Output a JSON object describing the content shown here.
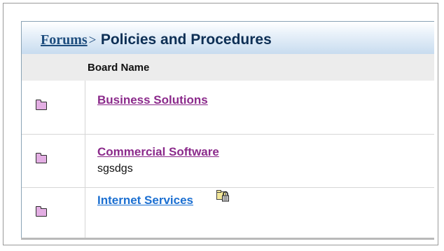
{
  "breadcrumb": {
    "root_label": "Forums",
    "separator": ">",
    "current_label": "Policies and Procedures"
  },
  "table": {
    "column_header": "Board Name",
    "rows": [
      {
        "name": "Business Solutions",
        "description": "",
        "visited": true,
        "locked": false,
        "icon": "folder-icon"
      },
      {
        "name": "Commercial Software",
        "description": "sgsdgs",
        "visited": true,
        "locked": false,
        "icon": "folder-icon"
      },
      {
        "name": "Internet Services",
        "description": "",
        "visited": false,
        "locked": true,
        "icon": "folder-icon"
      }
    ]
  },
  "colors": {
    "header_gradient_end": "#c8dcef",
    "visited_link": "#8b2a8b",
    "unvisited_link": "#1b6fd1",
    "folder_fill": "#e3aee3",
    "title_color": "#0d2f55"
  }
}
